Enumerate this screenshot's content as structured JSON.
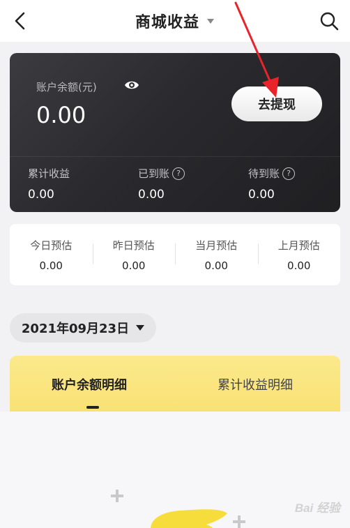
{
  "header": {
    "title": "商城收益"
  },
  "balance": {
    "label": "账户余额(元)",
    "amount": "0.00",
    "withdraw_label": "去提现",
    "stats": [
      {
        "label": "累计收益",
        "value": "0.00",
        "has_help": false
      },
      {
        "label": "已到账",
        "value": "0.00",
        "has_help": true
      },
      {
        "label": "待到账",
        "value": "0.00",
        "has_help": true
      }
    ],
    "help_glyph": "?"
  },
  "estimates": [
    {
      "label": "今日预估",
      "value": "0.00"
    },
    {
      "label": "昨日预估",
      "value": "0.00"
    },
    {
      "label": "当月预估",
      "value": "0.00"
    },
    {
      "label": "上月预估",
      "value": "0.00"
    }
  ],
  "date_filter": {
    "value": "2021年09月23日"
  },
  "tabs": [
    {
      "label": "账户余额明细",
      "active": true
    },
    {
      "label": "累计收益明细",
      "active": false
    }
  ],
  "watermark": "Bai 经验",
  "colors": {
    "card_dark": "#2a2a2e",
    "accent_yellow": "#f9e274",
    "annotation_red": "#e8242a"
  }
}
